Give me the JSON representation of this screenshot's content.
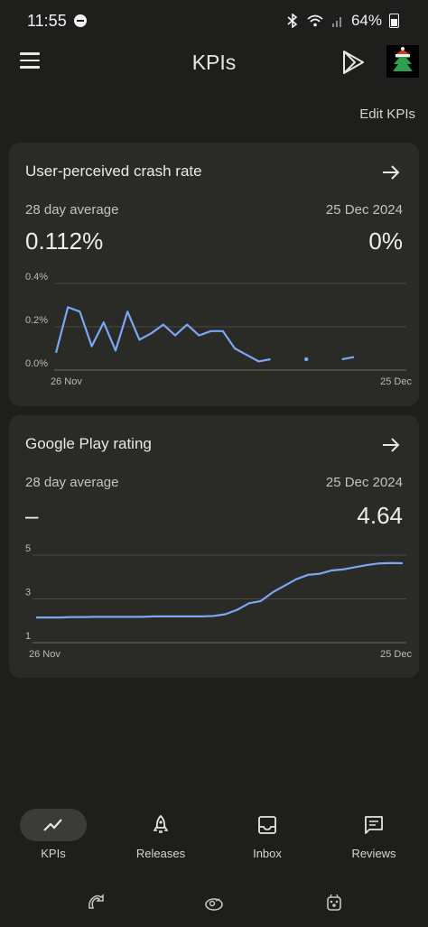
{
  "status_bar": {
    "time": "11:55",
    "battery": "64%"
  },
  "app_bar": {
    "title": "KPIs"
  },
  "edit_kpis": "Edit KPIs",
  "cards": [
    {
      "title": "User-perceived crash rate",
      "avg_label": "28 day average",
      "date_label": "25 Dec 2024",
      "avg_value": "0.112%",
      "date_value": "0%",
      "chart_data": {
        "type": "line",
        "x_start_label": "26 Nov",
        "x_end_label": "25 Dec",
        "yticks": [
          "0.4%",
          "0.2%",
          "0.0%"
        ],
        "ylim": [
          0,
          0.4
        ],
        "series": [
          {
            "values": [
              0.08,
              0.29,
              0.27,
              0.11,
              0.22,
              0.09,
              0.27,
              0.14,
              0.17,
              0.21,
              0.16,
              0.21,
              0.16,
              0.18,
              0.18,
              0.1,
              0.07,
              0.04,
              0.05,
              null,
              null,
              0.05,
              null,
              null,
              0.05,
              0.06
            ]
          }
        ],
        "color": "#7ba7f5"
      }
    },
    {
      "title": "Google Play rating",
      "avg_label": "28 day average",
      "date_label": "25 Dec 2024",
      "avg_value": "–",
      "date_value": "4.64",
      "chart_data": {
        "type": "line",
        "x_start_label": "26 Nov",
        "x_end_label": "25 Dec",
        "yticks": [
          "5",
          "3",
          "1"
        ],
        "ylim": [
          1,
          5
        ],
        "series": [
          {
            "values": [
              2.15,
              2.15,
              2.15,
              2.17,
              2.17,
              2.18,
              2.18,
              2.18,
              2.18,
              2.18,
              2.2,
              2.2,
              2.2,
              2.2,
              2.2,
              2.22,
              2.3,
              2.5,
              2.8,
              2.9,
              3.3,
              3.6,
              3.9,
              4.1,
              4.15,
              4.3,
              4.35,
              4.45,
              4.55,
              4.62,
              4.64,
              4.63
            ]
          }
        ],
        "color": "#7ba7f5"
      }
    }
  ],
  "nav": {
    "items": [
      {
        "label": "KPIs",
        "icon": "trend-icon",
        "active": true
      },
      {
        "label": "Releases",
        "icon": "rocket-icon",
        "active": false
      },
      {
        "label": "Inbox",
        "icon": "inbox-icon",
        "active": false
      },
      {
        "label": "Reviews",
        "icon": "reviews-icon",
        "active": false
      }
    ]
  }
}
